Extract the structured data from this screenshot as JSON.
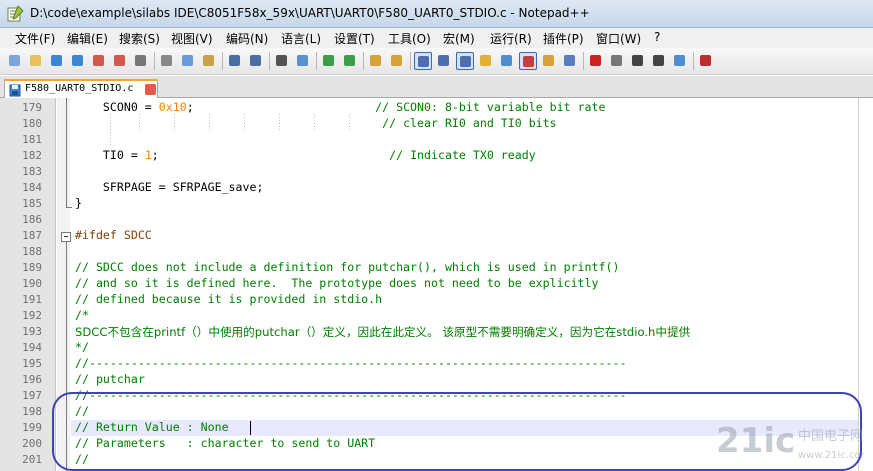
{
  "window": {
    "title": "D:\\code\\example\\silabs IDE\\C8051F58x_59x\\UART\\UART0\\F580_UART0_STDIO.c - Notepad++"
  },
  "menu": [
    "文件(F)",
    "编辑(E)",
    "搜索(S)",
    "视图(V)",
    "编码(N)",
    "语言(L)",
    "设置(T)",
    "工具(O)",
    "宏(M)",
    "运行(R)",
    "插件(P)",
    "窗口(W)",
    "?"
  ],
  "toolbar_icons": [
    "new-file-icon",
    "open-file-icon",
    "save-icon",
    "save-all-icon",
    "close-icon",
    "close-all-icon",
    "print-icon",
    "cut-icon",
    "copy-icon",
    "paste-icon",
    "undo-icon",
    "redo-icon",
    "find-icon",
    "replace-icon",
    "zoom-in-icon",
    "zoom-out-icon",
    "sync-vertical-icon",
    "sync-horizontal-icon",
    "word-wrap-icon",
    "show-all-chars-icon",
    "indent-guide-icon",
    "user-language-icon",
    "doc-map-icon",
    "function-list-icon",
    "folder-workspace-icon",
    "monitoring-icon",
    "record-macro-icon",
    "stop-record-icon",
    "play-macro-icon",
    "play-multiple-icon",
    "save-macro-icon",
    "spell-check-icon"
  ],
  "tab": {
    "label": "F580_UART0_STDIO.c"
  },
  "editor": {
    "lines": [
      {
        "n": "179",
        "code": "    SCON0 = ",
        "num": "0x10",
        "rest": ";                          ",
        "comment": "// SCON0: 8-bit variable bit rate"
      },
      {
        "n": "180",
        "code": "                                            ",
        "comment": "// clear RI0 and TI0 bits"
      },
      {
        "n": "181",
        "code": ""
      },
      {
        "n": "182",
        "code": "    TI0 = ",
        "num": "1",
        "rest": ";                                 ",
        "comment": "// Indicate TX0 ready"
      },
      {
        "n": "183",
        "code": ""
      },
      {
        "n": "184",
        "code": "    SFRPAGE = SFRPAGE_save;"
      },
      {
        "n": "185",
        "code": "}"
      },
      {
        "n": "186",
        "code": ""
      },
      {
        "n": "187",
        "pre": "#ifdef SDCC"
      },
      {
        "n": "188",
        "code": ""
      },
      {
        "n": "189",
        "comment": "// SDCC does not include a definition for putchar(), which is used in printf()"
      },
      {
        "n": "190",
        "comment": "// and so it is defined here.  The prototype does not need to be explicitly"
      },
      {
        "n": "191",
        "comment": "// defined because it is provided in stdio.h"
      },
      {
        "n": "192",
        "comment": "/*"
      },
      {
        "n": "193",
        "cn": "SDCC不包含在printf（）中使用的putchar（）定义，因此在此定义。 该原型不需要明确定义，因为它在stdio.h中提供"
      },
      {
        "n": "194",
        "comment": "*/"
      },
      {
        "n": "195",
        "comment": "//-----------------------------------------------------------------------------"
      },
      {
        "n": "196",
        "comment": "// putchar"
      },
      {
        "n": "197",
        "comment": "//-----------------------------------------------------------------------------"
      },
      {
        "n": "198",
        "comment": "//"
      },
      {
        "n": "199",
        "comment": "// Return Value : None"
      },
      {
        "n": "200",
        "comment": "// Parameters   : character to send to UART"
      },
      {
        "n": "201",
        "comment": "//"
      }
    ]
  },
  "watermark": {
    "logo": "21ic",
    "cn": "中国电子网",
    "url": "www.21ic.com"
  },
  "colors": {
    "comment": "#008000",
    "number": "#ff8000",
    "preprocessor": "#804000",
    "annotation_box": "#3d44b8"
  }
}
